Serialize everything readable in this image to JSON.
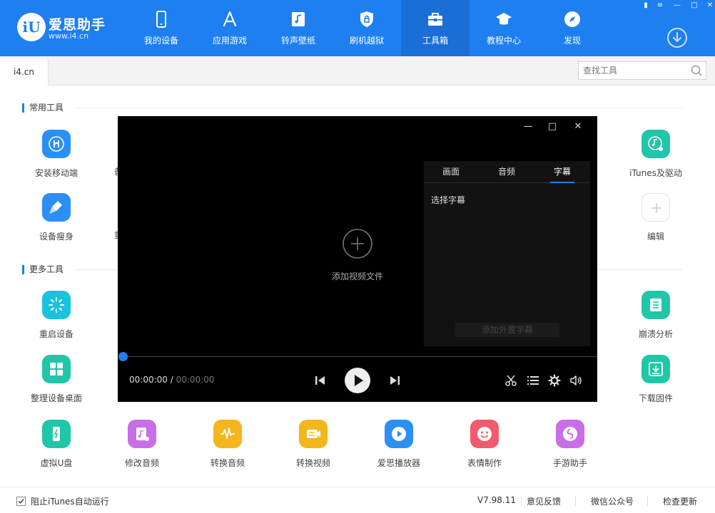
{
  "app": {
    "logo_mark": "iU",
    "title": "爱思助手",
    "url": "www.i4.cn"
  },
  "nav": [
    {
      "label": "我的设备",
      "icon": "phone-icon"
    },
    {
      "label": "应用游戏",
      "icon": "app-store-icon"
    },
    {
      "label": "铃声壁纸",
      "icon": "music-file-icon"
    },
    {
      "label": "刷机越狱",
      "icon": "shield-icon"
    },
    {
      "label": "工具箱",
      "icon": "toolbox-icon",
      "active": true
    },
    {
      "label": "教程中心",
      "icon": "graduation-cap-icon"
    },
    {
      "label": "发现",
      "icon": "compass-icon"
    }
  ],
  "tabs": {
    "current": "i4.cn"
  },
  "search": {
    "placeholder": "查找工具"
  },
  "sections": {
    "common": "常用工具",
    "more": "更多工具"
  },
  "tools": {
    "install_mobile": "安装移动端",
    "itunes_driver": "iTunes及驱动",
    "slim_device": "设备瘦身",
    "edit": "编辑",
    "restart_device": "重启设备",
    "crash_analysis": "崩溃分析",
    "organize_desktop": "整理设备桌面",
    "download_firmware": "下载固件",
    "virtual_udisk": "虚拟U盘",
    "edit_audio": "修改音频",
    "convert_audio": "转换音频",
    "convert_video": "转换视频",
    "i4_player": "爱思播放器",
    "emoji_maker": "表情制作",
    "game_helper": "手游助手"
  },
  "partial_labels": {
    "row1": "备",
    "row2": "重"
  },
  "player": {
    "add_video": "添加视频文件",
    "tabs": [
      "画面",
      "音频",
      "字幕"
    ],
    "active_tab": "字幕",
    "panel_text": "选择字幕",
    "panel_button": "添加外置字幕",
    "time_current": "00:00:00",
    "time_sep": "/",
    "time_total": "00:00:00",
    "progress": 0
  },
  "statusbar": {
    "checkbox_label": "阻止iTunes自动运行",
    "checkbox_checked": true,
    "version": "V7.98.11",
    "feedback": "意见反馈",
    "wechat": "微信公众号",
    "update": "检查更新"
  },
  "colors": {
    "brand": "#1e7ff0",
    "install_mobile": "#2b8ff5",
    "itunes_driver": "#1fc7a8",
    "slim_device": "#2b8ff5",
    "restart_device": "#19c3e0",
    "crash_analysis": "#1fc7a8",
    "organize_desktop": "#1fc7a8",
    "download_firmware": "#1fc7a8",
    "virtual_udisk": "#1fc7a8",
    "edit_audio": "#c86ee6",
    "convert_audio": "#f5b51d",
    "convert_video": "#f5b51d",
    "i4_player": "#2b8ff5",
    "emoji_maker": "#f25a6e",
    "game_helper": "#c86ee6"
  }
}
